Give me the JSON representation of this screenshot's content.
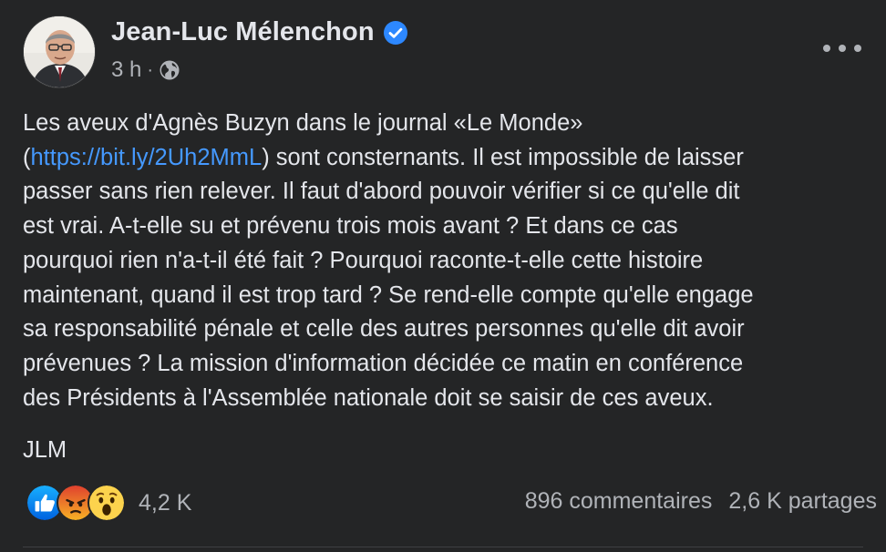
{
  "post": {
    "author": "Jean-Luc Mélenchon",
    "time": "3 h",
    "separator": "·",
    "verified_icon": "verified-badge-icon",
    "privacy_icon": "globe-icon",
    "body_before_link": "Les aveux d'Agnès Buzyn dans le journal «Le Monde»\n(",
    "link": "https://bit.ly/2Uh2MmL",
    "body_after_link": ") sont consternants. Il est impossible de laisser\npasser sans rien relever. Il faut d'abord pouvoir vérifier si ce qu'elle dit\nest vrai. A-t-elle su et prévenu trois mois avant ? Et dans ce cas\npourquoi rien n'a-t-il été fait ? Pourquoi raconte-t-elle cette histoire\nmaintenant, quand il est trop tard ? Se rend-elle compte qu'elle engage\nsa responsabilité pénale et celle des autres personnes qu'elle dit avoir\nprévenues ? La mission d'information décidée ce matin en conférence\ndes Présidents à l'Assemblée nationale doit se saisir de ces aveux.",
    "signature": "JLM"
  },
  "footer": {
    "reactions": [
      "like",
      "angry",
      "wow"
    ],
    "reaction_count": "4,2 K",
    "comments": "896 commentaires",
    "shares": "2,6 K partages"
  },
  "colors": {
    "background": "#242526",
    "text": "#e4e6eb",
    "secondary_text": "#b0b3b8",
    "link": "#4599ff",
    "verified": "#2d88ff"
  }
}
